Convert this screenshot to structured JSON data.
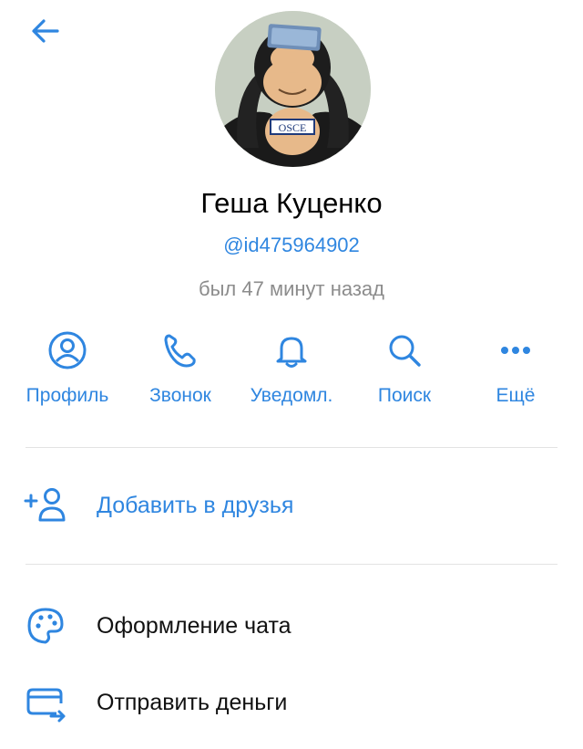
{
  "header": {
    "back_icon": "arrow-left-icon"
  },
  "profile": {
    "avatar_icon": "monkey-avatar-image",
    "avatar_badge": "OSCE",
    "name": "Геша Куценко",
    "handle": "@id475964902",
    "last_seen": "был 47 минут назад"
  },
  "actions": [
    {
      "label": "Профиль",
      "icon": "profile-icon"
    },
    {
      "label": "Звонок",
      "icon": "phone-icon"
    },
    {
      "label": "Уведомл.",
      "icon": "bell-icon"
    },
    {
      "label": "Поиск",
      "icon": "search-icon"
    },
    {
      "label": "Ещё",
      "icon": "more-dots-icon"
    }
  ],
  "menu": {
    "add_friend": {
      "label": "Добавить в друзья",
      "icon": "add-friend-icon"
    },
    "chat_theme": {
      "label": "Оформление чата",
      "icon": "palette-icon"
    },
    "send_money": {
      "label": "Отправить деньги",
      "icon": "send-money-icon"
    }
  },
  "colors": {
    "accent": "#2f86e0",
    "text": "#000000",
    "muted": "#8c8c8c",
    "divider": "#e3e3e3"
  }
}
